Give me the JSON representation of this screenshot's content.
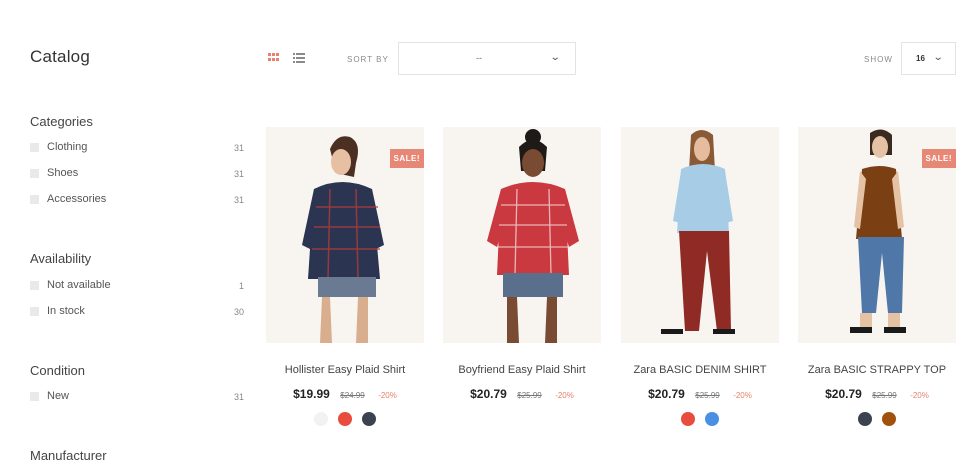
{
  "page": {
    "title": "Catalog"
  },
  "toolbar": {
    "sort_label": "SORT BY",
    "sort_value": "--",
    "show_label": "SHOW",
    "show_value": "16",
    "accent_color": "#e8806a"
  },
  "filters": [
    {
      "title": "Categories",
      "items": [
        {
          "label": "Clothing",
          "count": "31"
        },
        {
          "label": "Shoes",
          "count": "31"
        },
        {
          "label": "Accessories",
          "count": "31"
        }
      ]
    },
    {
      "title": "Availability",
      "items": [
        {
          "label": "Not available",
          "count": "1"
        },
        {
          "label": "In stock",
          "count": "30"
        }
      ]
    },
    {
      "title": "Condition",
      "items": [
        {
          "label": "New",
          "count": "31"
        }
      ]
    },
    {
      "title": "Manufacturer",
      "items": []
    }
  ],
  "products": [
    {
      "name": "Hollister Easy Plaid Shirt",
      "price": "$19.99",
      "old_price": "$24.99",
      "discount": "-20%",
      "badge": "SALE!",
      "swatches": [
        "#f2f2f2",
        "#e74c3c",
        "#3b4250"
      ]
    },
    {
      "name": "Boyfriend Easy Plaid Shirt",
      "price": "$20.79",
      "old_price": "$25.99",
      "discount": "-20%",
      "badge": "",
      "swatches": []
    },
    {
      "name": "Zara BASIC DENIM SHIRT",
      "price": "$20.79",
      "old_price": "$25.99",
      "discount": "-20%",
      "badge": "",
      "swatches": [
        "#e74c3c",
        "#4a90e2"
      ]
    },
    {
      "name": "Zara BASIC STRAPPY TOP",
      "price": "$20.79",
      "old_price": "$25.99",
      "discount": "-20%",
      "badge": "SALE!",
      "swatches": [
        "#3b4250",
        "#a0520d"
      ]
    }
  ]
}
